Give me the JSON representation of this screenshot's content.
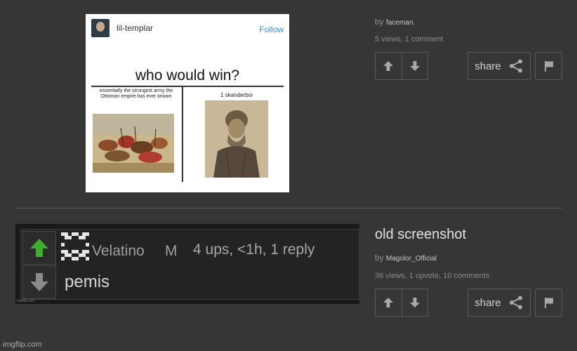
{
  "posts": [
    {
      "meme": {
        "username": "lil-templar",
        "follow_label": "Follow",
        "question": "who would win?",
        "left_caption": "essentially the strongest army the Ottoman empire has ever known",
        "right_caption": "1 skanderboi"
      },
      "title": "",
      "by_label": "by",
      "user": "faceman.",
      "stats": "5 views, 1 comment",
      "share_label": "share"
    },
    {
      "title": "old screenshot",
      "by_label": "by",
      "user": "Magolor_Official",
      "stats": "36 views, 1 upvote, 10 comments",
      "share_label": "share",
      "screenshot": {
        "name": "Velatino",
        "badge": "M",
        "meta": "4 ups, <1h, 1 reply",
        "text": "pemis",
        "credit": "imgflip.com"
      }
    }
  ],
  "watermark": "imgflip.com",
  "colors": {
    "background": "#363636",
    "upvote_green": "#3fae2a",
    "button_border": "#5a5a5a"
  },
  "icons": [
    "arrow-up-icon",
    "arrow-down-icon",
    "share-icon",
    "flag-icon"
  ]
}
